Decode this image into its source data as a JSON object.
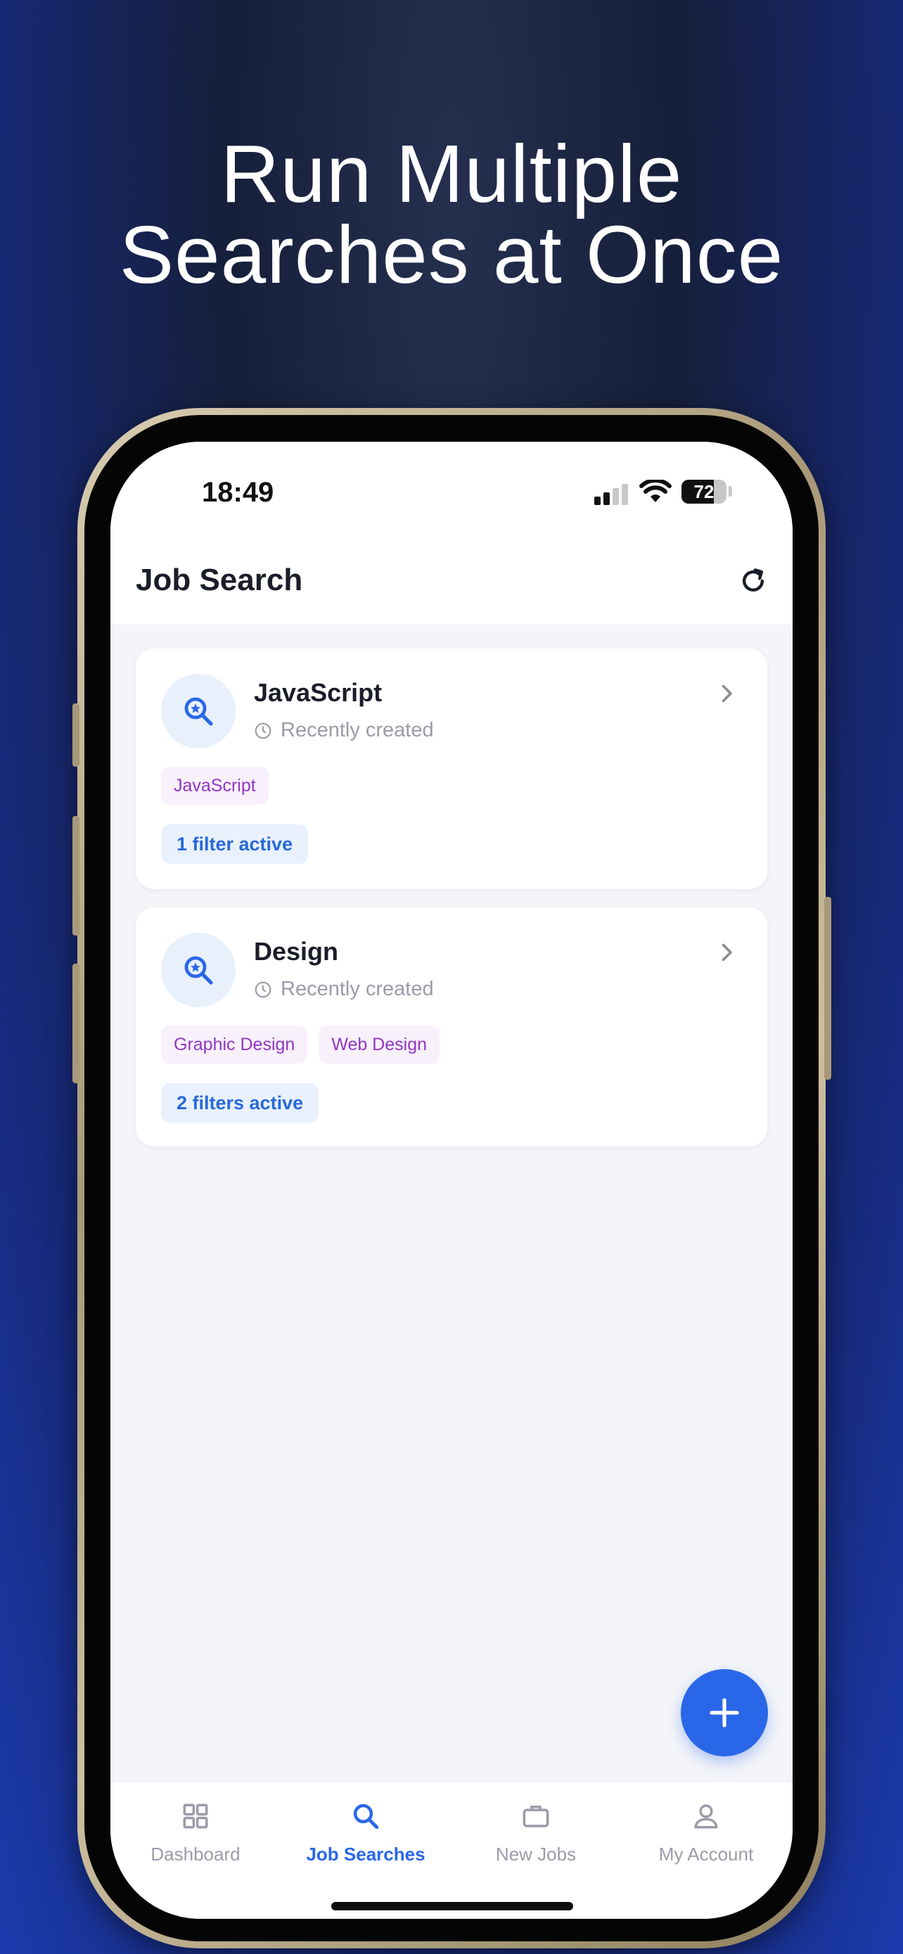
{
  "promo": {
    "headline_line1": "Run Multiple",
    "headline_line2": "Searches at Once"
  },
  "status_bar": {
    "time": "18:49",
    "battery_level": "72",
    "signal_bars_active": 2,
    "signal_bars_total": 4
  },
  "header": {
    "title": "Job Search",
    "refresh_icon": "refresh-icon"
  },
  "searches": [
    {
      "title": "JavaScript",
      "subtitle": "Recently created",
      "tags": [
        "JavaScript"
      ],
      "filters": "1 filter active"
    },
    {
      "title": "Design",
      "subtitle": "Recently created",
      "tags": [
        "Graphic Design",
        "Web Design"
      ],
      "filters": "2 filters active"
    }
  ],
  "tabs": [
    {
      "label": "Dashboard",
      "icon": "grid-icon",
      "active": false
    },
    {
      "label": "Job Searches",
      "icon": "search-icon",
      "active": true
    },
    {
      "label": "New Jobs",
      "icon": "briefcase-icon",
      "active": false
    },
    {
      "label": "My Account",
      "icon": "user-icon",
      "active": false
    }
  ],
  "colors": {
    "accent": "#2a67e8",
    "tag_text": "#9137c4",
    "tag_bg": "#f8f1fc",
    "filter_bg": "#e9f1fd",
    "muted": "#9a9ca8"
  }
}
